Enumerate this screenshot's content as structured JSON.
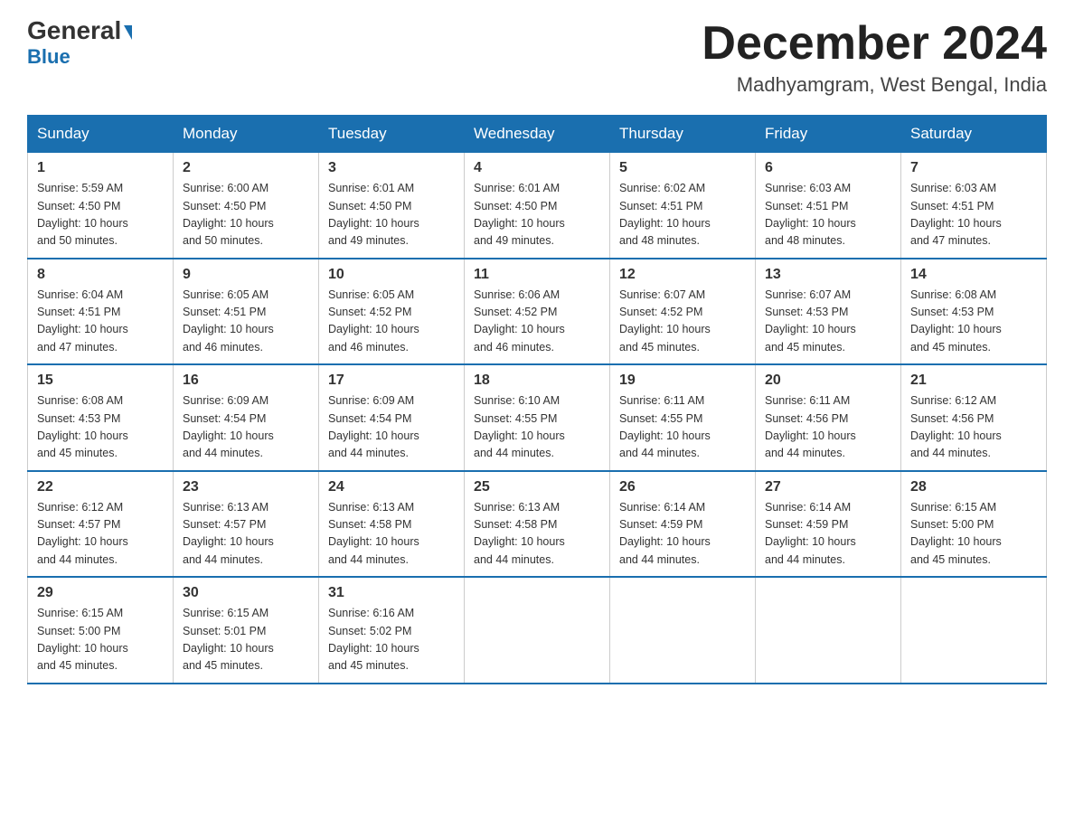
{
  "header": {
    "logo_general": "General",
    "logo_blue": "Blue",
    "month_title": "December 2024",
    "location": "Madhyamgram, West Bengal, India"
  },
  "weekdays": [
    "Sunday",
    "Monday",
    "Tuesday",
    "Wednesday",
    "Thursday",
    "Friday",
    "Saturday"
  ],
  "weeks": [
    [
      {
        "day": "1",
        "sunrise": "5:59 AM",
        "sunset": "4:50 PM",
        "daylight": "10 hours and 50 minutes."
      },
      {
        "day": "2",
        "sunrise": "6:00 AM",
        "sunset": "4:50 PM",
        "daylight": "10 hours and 50 minutes."
      },
      {
        "day": "3",
        "sunrise": "6:01 AM",
        "sunset": "4:50 PM",
        "daylight": "10 hours and 49 minutes."
      },
      {
        "day": "4",
        "sunrise": "6:01 AM",
        "sunset": "4:50 PM",
        "daylight": "10 hours and 49 minutes."
      },
      {
        "day": "5",
        "sunrise": "6:02 AM",
        "sunset": "4:51 PM",
        "daylight": "10 hours and 48 minutes."
      },
      {
        "day": "6",
        "sunrise": "6:03 AM",
        "sunset": "4:51 PM",
        "daylight": "10 hours and 48 minutes."
      },
      {
        "day": "7",
        "sunrise": "6:03 AM",
        "sunset": "4:51 PM",
        "daylight": "10 hours and 47 minutes."
      }
    ],
    [
      {
        "day": "8",
        "sunrise": "6:04 AM",
        "sunset": "4:51 PM",
        "daylight": "10 hours and 47 minutes."
      },
      {
        "day": "9",
        "sunrise": "6:05 AM",
        "sunset": "4:51 PM",
        "daylight": "10 hours and 46 minutes."
      },
      {
        "day": "10",
        "sunrise": "6:05 AM",
        "sunset": "4:52 PM",
        "daylight": "10 hours and 46 minutes."
      },
      {
        "day": "11",
        "sunrise": "6:06 AM",
        "sunset": "4:52 PM",
        "daylight": "10 hours and 46 minutes."
      },
      {
        "day": "12",
        "sunrise": "6:07 AM",
        "sunset": "4:52 PM",
        "daylight": "10 hours and 45 minutes."
      },
      {
        "day": "13",
        "sunrise": "6:07 AM",
        "sunset": "4:53 PM",
        "daylight": "10 hours and 45 minutes."
      },
      {
        "day": "14",
        "sunrise": "6:08 AM",
        "sunset": "4:53 PM",
        "daylight": "10 hours and 45 minutes."
      }
    ],
    [
      {
        "day": "15",
        "sunrise": "6:08 AM",
        "sunset": "4:53 PM",
        "daylight": "10 hours and 45 minutes."
      },
      {
        "day": "16",
        "sunrise": "6:09 AM",
        "sunset": "4:54 PM",
        "daylight": "10 hours and 44 minutes."
      },
      {
        "day": "17",
        "sunrise": "6:09 AM",
        "sunset": "4:54 PM",
        "daylight": "10 hours and 44 minutes."
      },
      {
        "day": "18",
        "sunrise": "6:10 AM",
        "sunset": "4:55 PM",
        "daylight": "10 hours and 44 minutes."
      },
      {
        "day": "19",
        "sunrise": "6:11 AM",
        "sunset": "4:55 PM",
        "daylight": "10 hours and 44 minutes."
      },
      {
        "day": "20",
        "sunrise": "6:11 AM",
        "sunset": "4:56 PM",
        "daylight": "10 hours and 44 minutes."
      },
      {
        "day": "21",
        "sunrise": "6:12 AM",
        "sunset": "4:56 PM",
        "daylight": "10 hours and 44 minutes."
      }
    ],
    [
      {
        "day": "22",
        "sunrise": "6:12 AM",
        "sunset": "4:57 PM",
        "daylight": "10 hours and 44 minutes."
      },
      {
        "day": "23",
        "sunrise": "6:13 AM",
        "sunset": "4:57 PM",
        "daylight": "10 hours and 44 minutes."
      },
      {
        "day": "24",
        "sunrise": "6:13 AM",
        "sunset": "4:58 PM",
        "daylight": "10 hours and 44 minutes."
      },
      {
        "day": "25",
        "sunrise": "6:13 AM",
        "sunset": "4:58 PM",
        "daylight": "10 hours and 44 minutes."
      },
      {
        "day": "26",
        "sunrise": "6:14 AM",
        "sunset": "4:59 PM",
        "daylight": "10 hours and 44 minutes."
      },
      {
        "day": "27",
        "sunrise": "6:14 AM",
        "sunset": "4:59 PM",
        "daylight": "10 hours and 44 minutes."
      },
      {
        "day": "28",
        "sunrise": "6:15 AM",
        "sunset": "5:00 PM",
        "daylight": "10 hours and 45 minutes."
      }
    ],
    [
      {
        "day": "29",
        "sunrise": "6:15 AM",
        "sunset": "5:00 PM",
        "daylight": "10 hours and 45 minutes."
      },
      {
        "day": "30",
        "sunrise": "6:15 AM",
        "sunset": "5:01 PM",
        "daylight": "10 hours and 45 minutes."
      },
      {
        "day": "31",
        "sunrise": "6:16 AM",
        "sunset": "5:02 PM",
        "daylight": "10 hours and 45 minutes."
      },
      null,
      null,
      null,
      null
    ]
  ],
  "labels": {
    "sunrise": "Sunrise:",
    "sunset": "Sunset:",
    "daylight": "Daylight:"
  }
}
